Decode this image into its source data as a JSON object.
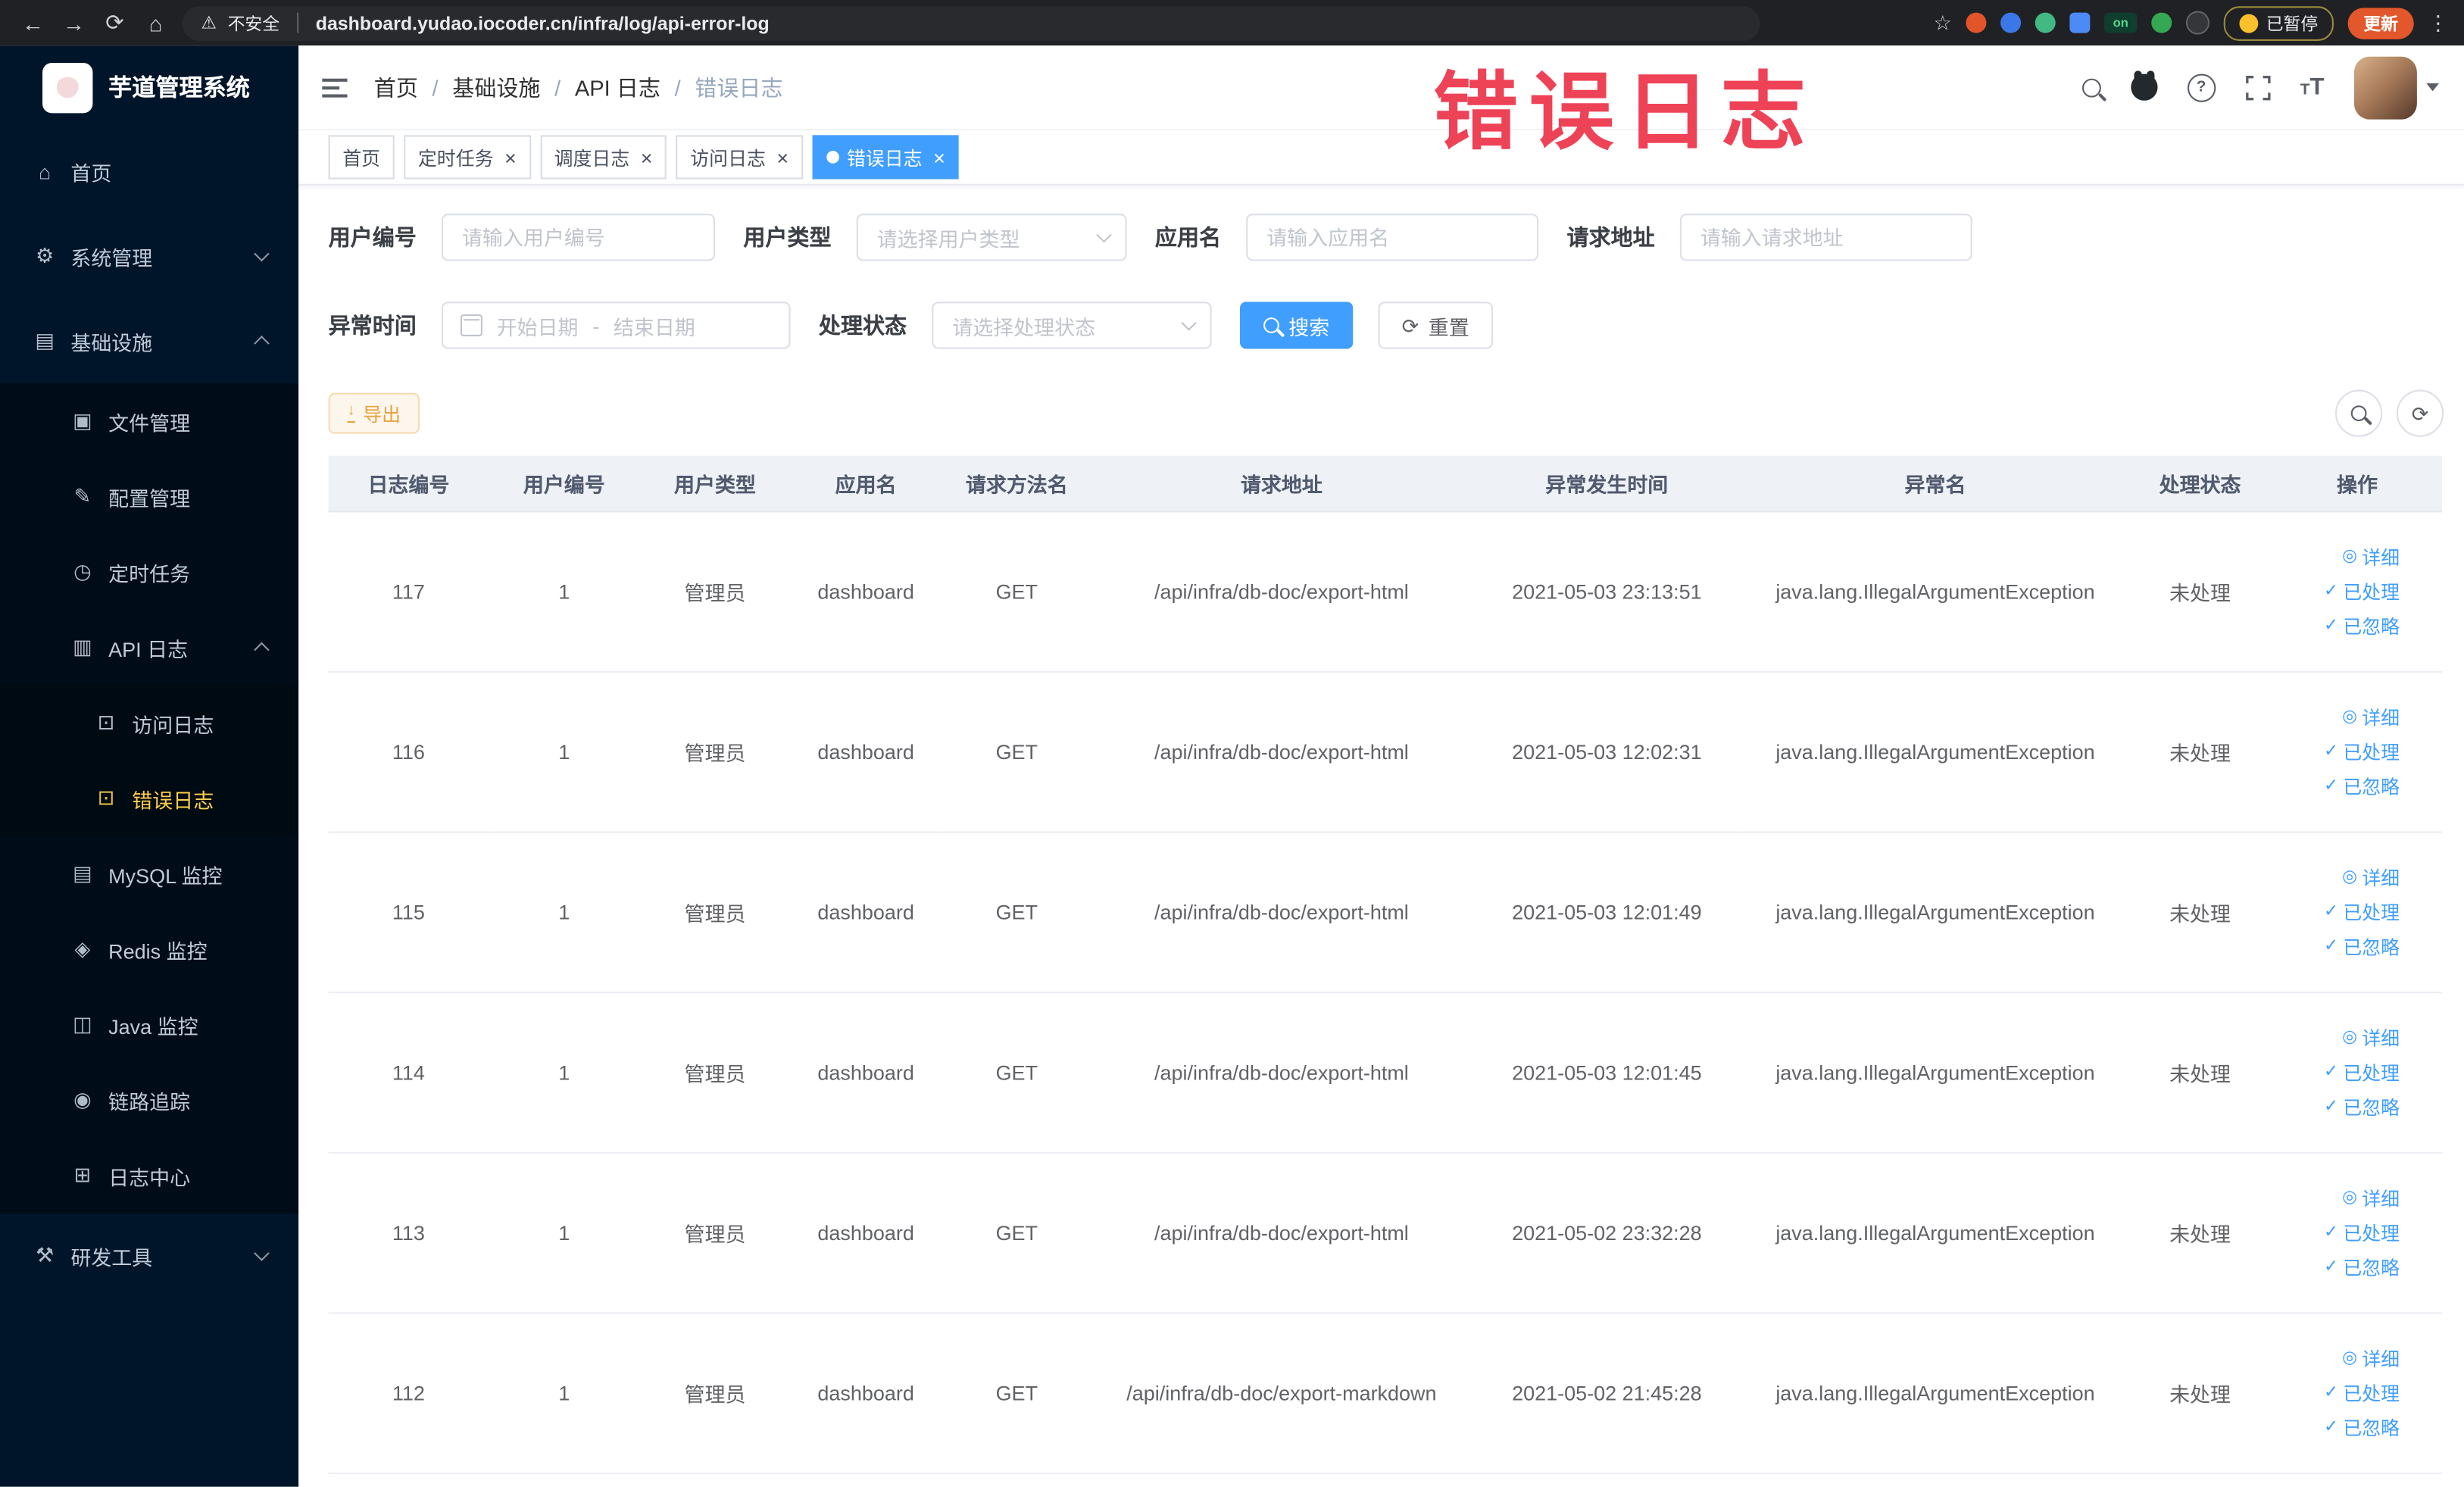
{
  "browser": {
    "security_label": "不安全",
    "url": "dashboard.yudao.iocoder.cn/infra/log/api-error-log",
    "ext_on_label": "on",
    "paused_badge": "已暂停",
    "update_label": "更新"
  },
  "annotation": "错误日志",
  "sidebar": {
    "logo_title": "芋道管理系统",
    "menu": [
      {
        "key": "home",
        "label": "首页",
        "icon": "home-icon",
        "level": 1,
        "type": "leaf"
      },
      {
        "key": "system-admin",
        "label": "系统管理",
        "icon": "gear-icon",
        "level": 1,
        "type": "submenu",
        "state": "collapsed"
      },
      {
        "key": "infrastructure",
        "label": "基础设施",
        "icon": "infra-icon",
        "level": 1,
        "type": "submenu",
        "state": "expanded"
      },
      {
        "key": "file-management",
        "label": "文件管理",
        "icon": "file-icon",
        "level": 2,
        "type": "leaf"
      },
      {
        "key": "config-management",
        "label": "配置管理",
        "icon": "config-icon",
        "level": 2,
        "type": "leaf"
      },
      {
        "key": "scheduled-tasks",
        "label": "定时任务",
        "icon": "clock-icon",
        "level": 2,
        "type": "leaf"
      },
      {
        "key": "api-log",
        "label": "API 日志",
        "icon": "api-log-icon",
        "level": 2,
        "type": "submenu",
        "state": "expanded"
      },
      {
        "key": "access-log",
        "label": "访问日志",
        "icon": "doc-edit-icon",
        "level": 3,
        "type": "leaf"
      },
      {
        "key": "error-log",
        "label": "错误日志",
        "icon": "doc-edit-icon",
        "level": 3,
        "type": "leaf",
        "active": true
      },
      {
        "key": "mysql-monitor",
        "label": "MySQL 监控",
        "icon": "mysql-icon",
        "level": 2,
        "type": "leaf"
      },
      {
        "key": "redis-monitor",
        "label": "Redis 监控",
        "icon": "redis-icon",
        "level": 2,
        "type": "leaf"
      },
      {
        "key": "java-monitor",
        "label": "Java 监控",
        "icon": "java-icon",
        "level": 2,
        "type": "leaf"
      },
      {
        "key": "trace",
        "label": "链路追踪",
        "icon": "trace-icon",
        "level": 2,
        "type": "leaf"
      },
      {
        "key": "log-center",
        "label": "日志中心",
        "icon": "log-center-icon",
        "level": 2,
        "type": "leaf"
      },
      {
        "key": "dev-tools",
        "label": "研发工具",
        "icon": "tools-icon",
        "level": 1,
        "type": "submenu",
        "state": "collapsed"
      }
    ]
  },
  "header": {
    "breadcrumb": [
      "首页",
      "基础设施",
      "API 日志",
      "错误日志"
    ],
    "breadcrumb_separator": "/"
  },
  "tags": [
    {
      "key": "home",
      "label": "首页",
      "closable": false,
      "active": false
    },
    {
      "key": "timed-task",
      "label": "定时任务",
      "closable": true,
      "active": false
    },
    {
      "key": "schedule-log",
      "label": "调度日志",
      "closable": true,
      "active": false
    },
    {
      "key": "access-log",
      "label": "访问日志",
      "closable": true,
      "active": false
    },
    {
      "key": "error-log",
      "label": "错误日志",
      "closable": true,
      "active": true
    }
  ],
  "filters": {
    "user_id": {
      "label": "用户编号",
      "placeholder": "请输入用户编号"
    },
    "user_type": {
      "label": "用户类型",
      "placeholder": "请选择用户类型"
    },
    "app_name": {
      "label": "应用名",
      "placeholder": "请输入应用名"
    },
    "request_url": {
      "label": "请求地址",
      "placeholder": "请输入请求地址"
    },
    "exception_time": {
      "label": "异常时间",
      "start_placeholder": "开始日期",
      "separator": "-",
      "end_placeholder": "结束日期"
    },
    "process_status": {
      "label": "处理状态",
      "placeholder": "请选择处理状态"
    },
    "search_label": "搜索",
    "reset_label": "重置"
  },
  "toolbar": {
    "export_label": "导出"
  },
  "table": {
    "headers": [
      "日志编号",
      "用户编号",
      "用户类型",
      "应用名",
      "请求方法名",
      "请求地址",
      "异常发生时间",
      "异常名",
      "处理状态",
      "操作"
    ],
    "action_labels": [
      "详细",
      "已处理",
      "已忽略"
    ],
    "rows": [
      [
        "117",
        "1",
        "管理员",
        "dashboard",
        "GET",
        "/api/infra/db-doc/export-html",
        "2021-05-03 23:13:51",
        "java.lang.IllegalArgumentException",
        "未处理"
      ],
      [
        "116",
        "1",
        "管理员",
        "dashboard",
        "GET",
        "/api/infra/db-doc/export-html",
        "2021-05-03 12:02:31",
        "java.lang.IllegalArgumentException",
        "未处理"
      ],
      [
        "115",
        "1",
        "管理员",
        "dashboard",
        "GET",
        "/api/infra/db-doc/export-html",
        "2021-05-03 12:01:49",
        "java.lang.IllegalArgumentException",
        "未处理"
      ],
      [
        "114",
        "1",
        "管理员",
        "dashboard",
        "GET",
        "/api/infra/db-doc/export-html",
        "2021-05-03 12:01:45",
        "java.lang.IllegalArgumentException",
        "未处理"
      ],
      [
        "113",
        "1",
        "管理员",
        "dashboard",
        "GET",
        "/api/infra/db-doc/export-html",
        "2021-05-02 23:32:28",
        "java.lang.IllegalArgumentException",
        "未处理"
      ],
      [
        "112",
        "1",
        "管理员",
        "dashboard",
        "GET",
        "/api/infra/db-doc/export-markdown",
        "2021-05-02 21:45:28",
        "java.lang.IllegalArgumentException",
        "未处理"
      ]
    ]
  },
  "colors": {
    "primary": "#409eff",
    "warning": "#e6a23c",
    "sidebar_bg": "#001529",
    "sidebar_sub_bg": "#000c17",
    "active_menu": "#ffd04b",
    "annotation_red": "#ee4257"
  }
}
